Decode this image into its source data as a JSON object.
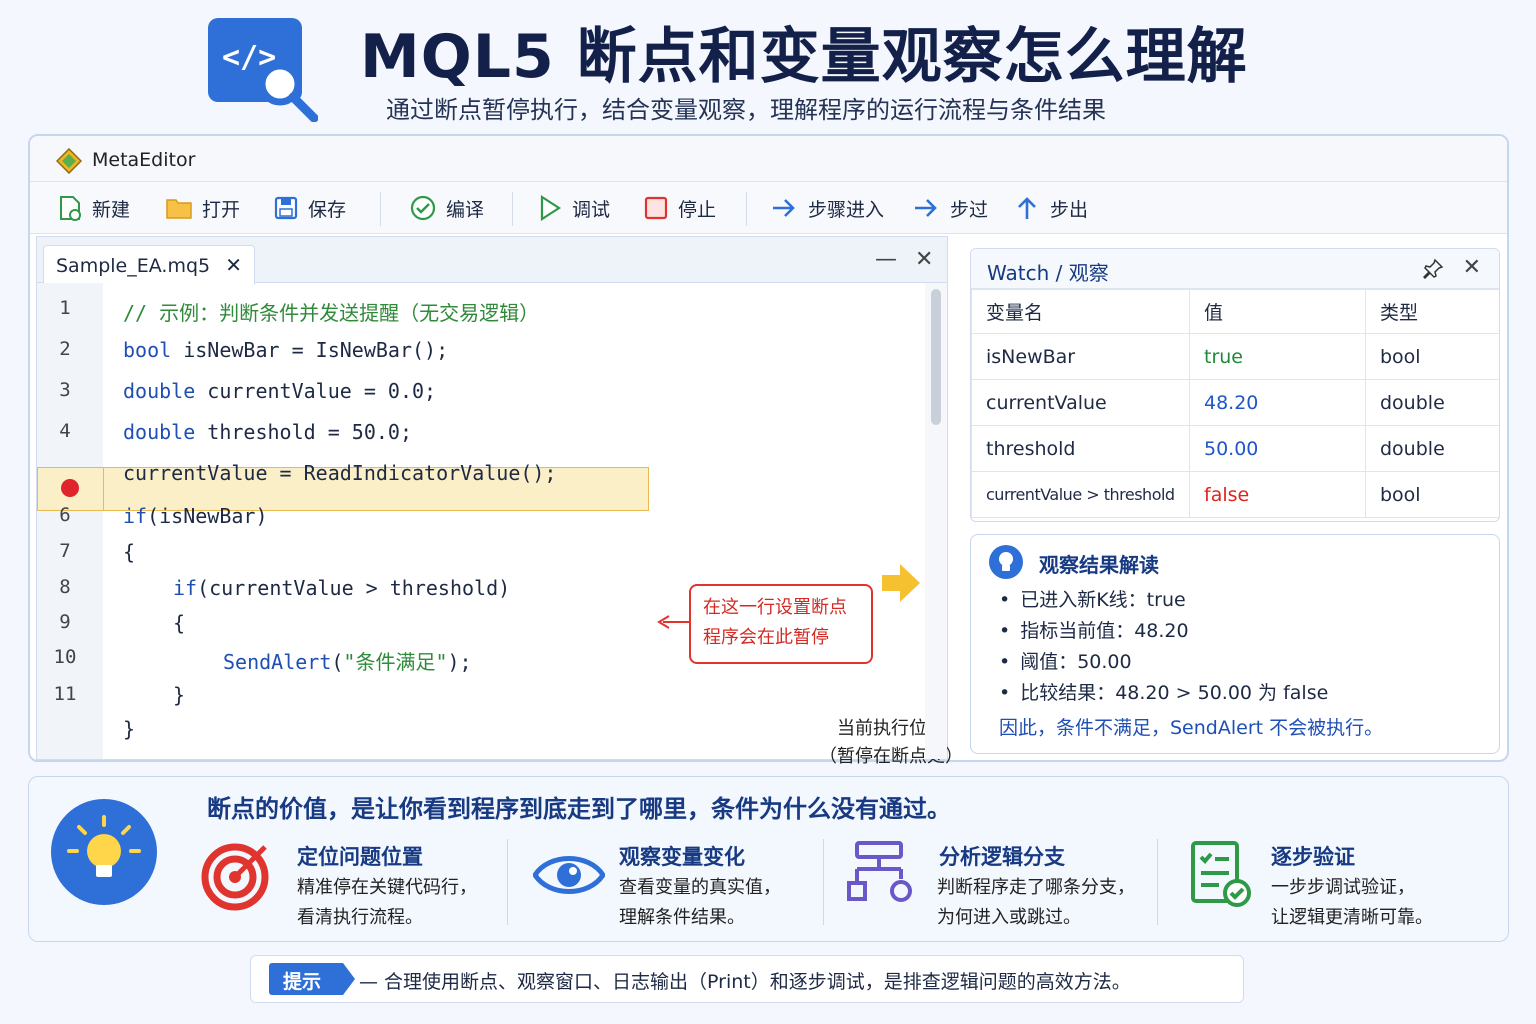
{
  "header": {
    "logo_code": "</>",
    "title": "MQL5 断点和变量观察怎么理解",
    "subtitle": "通过断点暂停执行，结合变量观察，理解程序的运行流程与条件结果"
  },
  "window": {
    "app_name": "MetaEditor"
  },
  "toolbar": {
    "new": "新建",
    "open": "打开",
    "save": "保存",
    "compile": "编译",
    "debug": "调试",
    "stop": "停止",
    "step_into": "步骤进入",
    "step_over": "步过",
    "step_out": "步出"
  },
  "editor": {
    "tab": "Sample_EA.mq5",
    "tab_close": "✕",
    "minimize": "—",
    "close": "✕",
    "line_numbers": [
      "1",
      "2",
      "3",
      "4",
      "6",
      "7",
      "8",
      "9",
      "10",
      "11"
    ],
    "code": {
      "l1": "// 示例：判断条件并发送提醒（无交易逻辑）",
      "l2_kw": "bool",
      "l2_rest": " isNewBar = IsNewBar();",
      "l3_kw": "double",
      "l3_rest": " currentValue = 0.0;",
      "l4_kw": "double",
      "l4_rest": " threshold = 50.0;",
      "l5": "currentValue = ReadIndicatorValue();",
      "l6_kw": "if",
      "l6_rest": "(isNewBar)",
      "l7": "{",
      "l8_kw": "if",
      "l8_rest": "(currentValue > threshold)",
      "l9": "{",
      "l10_kw": "SendAlert",
      "l10_p1": "(",
      "l10_str": "\"条件满足\"",
      "l10_p2": ");",
      "l11": "}",
      "l12": "}"
    },
    "breakpoint_note": [
      "在这一行设置断点",
      "程序会在此暂停"
    ],
    "exec_note": [
      "当前执行位置",
      "（暂停在断点处）"
    ]
  },
  "watch": {
    "title": "Watch / 观察",
    "columns": [
      "变量名",
      "值",
      "类型"
    ],
    "rows": [
      {
        "name": "isNewBar",
        "value": "true",
        "type": "bool"
      },
      {
        "name": "currentValue",
        "value": "48.20",
        "type": "double"
      },
      {
        "name": "threshold",
        "value": "50.00",
        "type": "double"
      },
      {
        "name": "currentValue > threshold",
        "value": "false",
        "type": "bool"
      }
    ]
  },
  "interpretation": {
    "title": "观察结果解读",
    "items": [
      "已进入新K线：true",
      "指标当前值：48.20",
      "阈值：50.00",
      "比较结果：48.20 > 50.00 为 false"
    ],
    "conclusion": "因此，条件不满足，SendAlert 不会被执行。"
  },
  "value_panel": {
    "headline": "断点的价值，是让你看到程序到底走到了哪里，条件为什么没有通过。",
    "features": [
      {
        "title": "定位问题位置",
        "lines": [
          "精准停在关键代码行，",
          "看清执行流程。"
        ]
      },
      {
        "title": "观察变量变化",
        "lines": [
          "查看变量的真实值，",
          "理解条件结果。"
        ]
      },
      {
        "title": "分析逻辑分支",
        "lines": [
          "判断程序走了哪条分支，",
          "为何进入或跳过。"
        ]
      },
      {
        "title": "逐步验证",
        "lines": [
          "一步步调试验证，",
          "让逻辑更清晰可靠。"
        ]
      }
    ]
  },
  "tip": {
    "badge": "提示",
    "text": "— 合理使用断点、观察窗口、日志输出（Print）和逐步调试，是排查逻辑问题的高效方法。"
  },
  "colors": {
    "accent": "#2f6fd8",
    "breakpoint": "#e0242b",
    "highlight": "#fbefc8",
    "true": "#1f8a3a",
    "false": "#e0241c"
  }
}
